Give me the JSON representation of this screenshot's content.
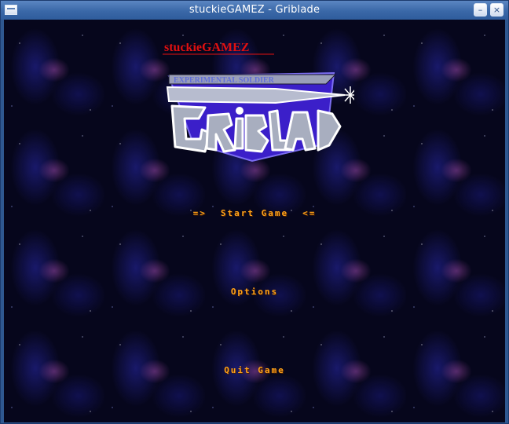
{
  "window": {
    "title": "stuckieGAMEZ - Griblade",
    "min_glyph": "–",
    "close_glyph": "×"
  },
  "logo": {
    "publisher": "stuckieGAMEZ",
    "subtitle": "EXPERIMENTAL SOLDIER",
    "wordmark": "GRiBLADE"
  },
  "menu": {
    "selector_left": "=>",
    "selector_right": "<=",
    "start": "Start Game",
    "options": "Options",
    "quit": "Quit Game"
  },
  "colors": {
    "menu_text": "#ffa21a",
    "publisher_text": "#e01010",
    "shield": "#3b1fc9",
    "titlebar": "#3a68a8"
  }
}
